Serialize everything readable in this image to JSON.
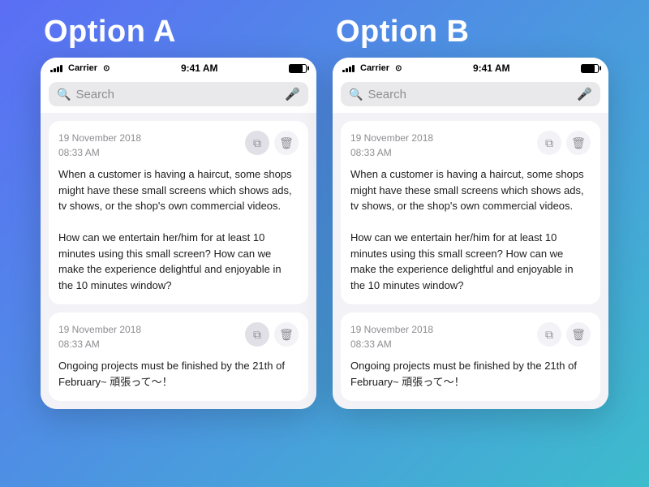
{
  "options": [
    {
      "id": "option-a",
      "title": "Option A",
      "statusBar": {
        "carrier": "Carrier",
        "wifi": "wifi",
        "time": "9:41 AM"
      },
      "search": {
        "placeholder": "Search"
      },
      "cards": [
        {
          "id": "card-a-1",
          "date": "19 November 2018",
          "time": "08:33 AM",
          "text": "When a customer is having a haircut, some shops might have these small screens which shows ads, tv shows, or the shop's own commercial videos.\n\nHow can we entertain her/him for at least 10 minutes using this small screen? How can we make the experience delightful and enjoyable in the 10 minutes window?",
          "copyActive": true
        },
        {
          "id": "card-a-2",
          "date": "19 November 2018",
          "time": "08:33 AM",
          "text": "Ongoing projects must be finished by the 21th of February~ 頑張って～！",
          "copyActive": false
        }
      ]
    },
    {
      "id": "option-b",
      "title": "Option B",
      "statusBar": {
        "carrier": "Carrier",
        "wifi": "wifi",
        "time": "9:41 AM"
      },
      "search": {
        "placeholder": "Search"
      },
      "cards": [
        {
          "id": "card-b-1",
          "date": "19 November 2018",
          "time": "08:33 AM",
          "text": "When a customer is having a haircut, some shops might have these small screens which shows ads, tv shows, or the shop's own commercial videos.\n\nHow can we entertain her/him for at least 10 minutes using this small screen? How can we make the experience delightful and enjoyable in the 10 minutes window?",
          "copyActive": false
        },
        {
          "id": "card-b-2",
          "date": "19 November 2018",
          "time": "08:33 AM",
          "text": "Ongoing projects must be finished by the 21th of February~ 頑張って～！",
          "copyActive": false
        }
      ]
    }
  ]
}
